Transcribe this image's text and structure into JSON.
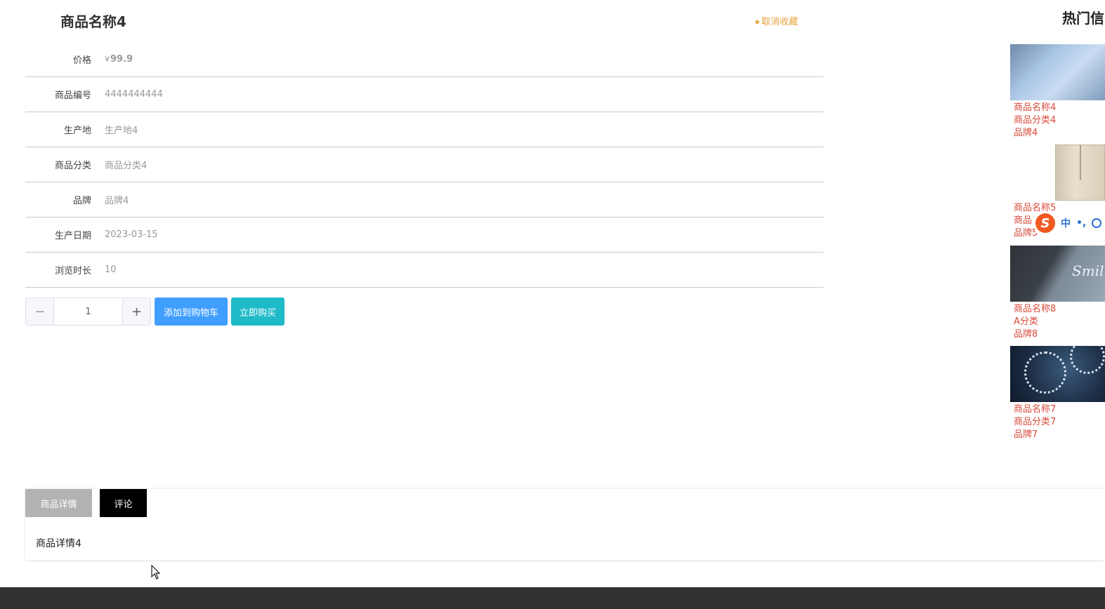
{
  "product": {
    "name": "商品名称4",
    "favorite_label": "取消收藏",
    "fields": [
      {
        "label": "价格",
        "currency": "¥",
        "value": "99.9"
      },
      {
        "label": "商品编号",
        "value": "4444444444"
      },
      {
        "label": "生产地",
        "value": "生产地4"
      },
      {
        "label": "商品分类",
        "value": "商品分类4"
      },
      {
        "label": "品牌",
        "value": "品牌4"
      },
      {
        "label": "生产日期",
        "value": "2023-03-15"
      },
      {
        "label": "浏览时长",
        "value": "10"
      }
    ]
  },
  "quantity": {
    "value": "1",
    "minus_icon": "minus-icon",
    "plus_icon": "plus-icon"
  },
  "actions": {
    "add_to_cart": "添加到购物车",
    "buy_now": "立即购买"
  },
  "sidebar": {
    "title": "热门信",
    "items": [
      {
        "name": "商品名称4",
        "category": "商品分类4",
        "brand": "品牌4"
      },
      {
        "name": "商品名称5",
        "category": "商品",
        "brand": "品牌5"
      },
      {
        "name": "商品名称8",
        "category": "A分类",
        "brand": "品牌8"
      },
      {
        "name": "商品名称7",
        "category": "商品分类7",
        "brand": "品牌7"
      }
    ]
  },
  "ime": {
    "logo": "S",
    "mode": "中",
    "punct": "•,"
  },
  "tabs": {
    "items": [
      {
        "label": "商品详情"
      },
      {
        "label": "评论"
      }
    ],
    "content": "商品详情4"
  },
  "colors": {
    "favorite": "#e6a23c",
    "primary": "#409eff",
    "buy": "#1fbac8",
    "side_text": "#d84a3a",
    "footer": "#313131"
  }
}
